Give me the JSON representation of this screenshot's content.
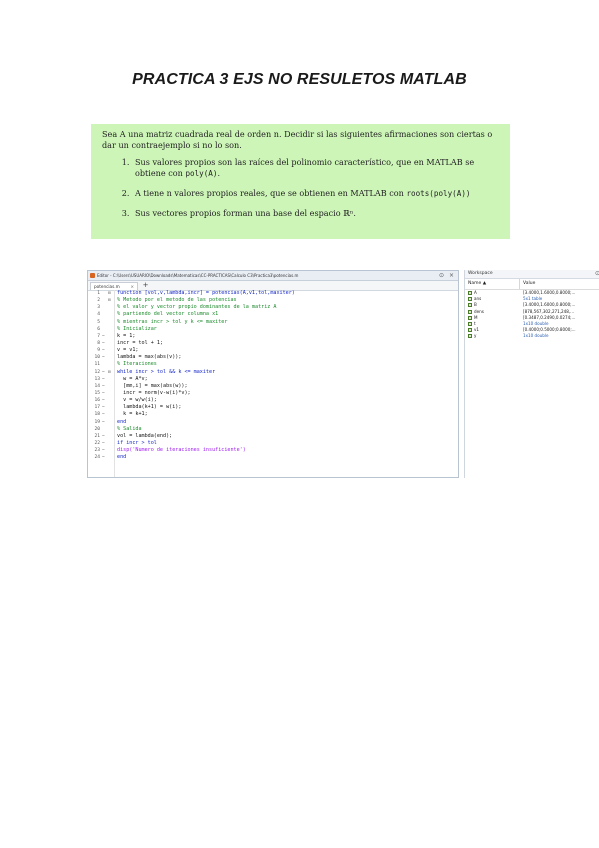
{
  "document": {
    "title": "PRACTICA 3 EJS NO RESULETOS MATLAB",
    "exercise": {
      "intro": "Sea A una matriz cuadrada real de orden n. Decidir si las siguientes afirmaciones son ciertas o dar un contraejemplo si no lo son.",
      "items": [
        {
          "text_before": "Sus valores propios son las raíces del polinomio característico, que en MATLAB se obtiene con ",
          "code": "poly(A)",
          "text_after": "."
        },
        {
          "text_before": "A tiene n valores propios reales, que se obtienen en MATLAB con ",
          "code": "roots(poly(A))",
          "text_after": ""
        },
        {
          "text_before": "Sus vectores propios forman una base del espacio ℝⁿ.",
          "code": "",
          "text_after": ""
        }
      ]
    }
  },
  "screenshot": {
    "editor": {
      "title": "Editor - C:\\Users\\USUARIO\\Downloads\\Matematicas\\CC-PRACTICAS\\Calculo C3\\Practica3\\potencias.m",
      "tab_label": "potencias.m",
      "tab_close": "×",
      "tab_add": "+",
      "controls": [
        "⊙",
        "×"
      ],
      "lines": [
        {
          "n": "1",
          "bp": "",
          "fold": "⊟",
          "type": "kw",
          "text": "function [vol,v,lambda,incr] = potencias(A,v1,tol,maxiter)"
        },
        {
          "n": "2",
          "bp": "",
          "fold": "⊟",
          "type": "cm",
          "text": "% Metodo por el metodo de las potencias"
        },
        {
          "n": "3",
          "bp": "",
          "fold": "",
          "type": "cm",
          "text": "% el valor y vector propio dominantes de la matriz A"
        },
        {
          "n": "4",
          "bp": "",
          "fold": "",
          "type": "cm",
          "text": "% partiendo del vector columna x1"
        },
        {
          "n": "5",
          "bp": "",
          "fold": "",
          "type": "cm",
          "text": "% mientras incr > tol y k <= maxiter"
        },
        {
          "n": "6",
          "bp": "",
          "fold": "",
          "type": "cm",
          "text": "% Inicializar"
        },
        {
          "n": "7",
          "bp": "−",
          "fold": "",
          "type": "nm",
          "text": "k = 1;"
        },
        {
          "n": "8",
          "bp": "−",
          "fold": "",
          "type": "nm",
          "text": "incr = tol + 1;"
        },
        {
          "n": "9",
          "bp": "−",
          "fold": "",
          "type": "nm",
          "text": "v = v1;"
        },
        {
          "n": "10",
          "bp": "−",
          "fold": "",
          "type": "nm",
          "text": "lambda = max(abs(v));"
        },
        {
          "n": "11",
          "bp": "",
          "fold": "",
          "type": "cm",
          "text": "% Iteraciones"
        },
        {
          "n": "12",
          "bp": "−",
          "fold": "⊟",
          "type": "kw",
          "text": "while incr > tol && k <= maxiter"
        },
        {
          "n": "13",
          "bp": "−",
          "fold": "",
          "type": "nm",
          "text": "  w = A*v;"
        },
        {
          "n": "14",
          "bp": "−",
          "fold": "",
          "type": "nm",
          "text": "  [mm,i] = max(abs(w));"
        },
        {
          "n": "15",
          "bp": "−",
          "fold": "",
          "type": "nm",
          "text": "  incr = norm(v-w(i)*v);"
        },
        {
          "n": "16",
          "bp": "−",
          "fold": "",
          "type": "nm",
          "text": "  v = w/w(i);"
        },
        {
          "n": "17",
          "bp": "−",
          "fold": "",
          "type": "nm",
          "text": "  lambda(k+1) = w(i);"
        },
        {
          "n": "18",
          "bp": "−",
          "fold": "",
          "type": "nm",
          "text": "  k = k+1;"
        },
        {
          "n": "19",
          "bp": "−",
          "fold": "",
          "type": "kw",
          "text": "end"
        },
        {
          "n": "20",
          "bp": "",
          "fold": "",
          "type": "cm",
          "text": "% Salida"
        },
        {
          "n": "21",
          "bp": "−",
          "fold": "",
          "type": "nm",
          "text": "vol = lambda(end);"
        },
        {
          "n": "22",
          "bp": "−",
          "fold": "",
          "type": "kw",
          "text": "if incr > tol"
        },
        {
          "n": "23",
          "bp": "−",
          "fold": "",
          "type": "st",
          "text": "disp('Numero de iteraciones insuficiente')"
        },
        {
          "n": "24",
          "bp": "−",
          "fold": "",
          "type": "kw",
          "text": "end"
        }
      ]
    },
    "workspace": {
      "title": "Workspace",
      "menu_icon": "⊙",
      "col_name": "Name ▲",
      "col_value": "Value",
      "rows": [
        {
          "name": "A",
          "value": "[3.4000,1.6000,0.8000;...",
          "blue": false
        },
        {
          "name": "ans",
          "value": "5x1 table",
          "blue": true
        },
        {
          "name": "B",
          "value": "[3.4000,1.6000,0.8000;...",
          "blue": false
        },
        {
          "name": "dens",
          "value": "[878,567,302,271,248,...",
          "blue": false
        },
        {
          "name": "M",
          "value": "[0.3487,0.2490,0.0274;...",
          "blue": false
        },
        {
          "name": "t",
          "value": "1x10 double",
          "blue": true
        },
        {
          "name": "v1",
          "value": "[0.4000;0.5000;0.8000;...",
          "blue": false
        },
        {
          "name": "y",
          "value": "1x10 double",
          "blue": true
        }
      ]
    }
  }
}
